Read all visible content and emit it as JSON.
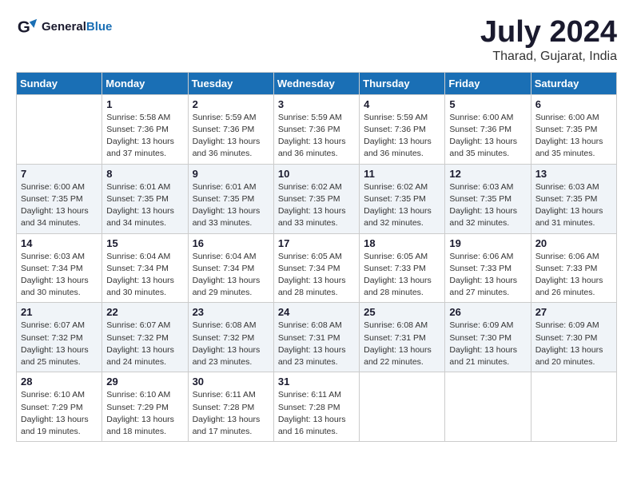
{
  "logo": {
    "text_general": "General",
    "text_blue": "Blue"
  },
  "header": {
    "month": "July 2024",
    "location": "Tharad, Gujarat, India"
  },
  "weekdays": [
    "Sunday",
    "Monday",
    "Tuesday",
    "Wednesday",
    "Thursday",
    "Friday",
    "Saturday"
  ],
  "weeks": [
    [
      {
        "num": "",
        "info": ""
      },
      {
        "num": "1",
        "info": "Sunrise: 5:58 AM\nSunset: 7:36 PM\nDaylight: 13 hours\nand 37 minutes."
      },
      {
        "num": "2",
        "info": "Sunrise: 5:59 AM\nSunset: 7:36 PM\nDaylight: 13 hours\nand 36 minutes."
      },
      {
        "num": "3",
        "info": "Sunrise: 5:59 AM\nSunset: 7:36 PM\nDaylight: 13 hours\nand 36 minutes."
      },
      {
        "num": "4",
        "info": "Sunrise: 5:59 AM\nSunset: 7:36 PM\nDaylight: 13 hours\nand 36 minutes."
      },
      {
        "num": "5",
        "info": "Sunrise: 6:00 AM\nSunset: 7:36 PM\nDaylight: 13 hours\nand 35 minutes."
      },
      {
        "num": "6",
        "info": "Sunrise: 6:00 AM\nSunset: 7:35 PM\nDaylight: 13 hours\nand 35 minutes."
      }
    ],
    [
      {
        "num": "7",
        "info": "Sunrise: 6:00 AM\nSunset: 7:35 PM\nDaylight: 13 hours\nand 34 minutes."
      },
      {
        "num": "8",
        "info": "Sunrise: 6:01 AM\nSunset: 7:35 PM\nDaylight: 13 hours\nand 34 minutes."
      },
      {
        "num": "9",
        "info": "Sunrise: 6:01 AM\nSunset: 7:35 PM\nDaylight: 13 hours\nand 33 minutes."
      },
      {
        "num": "10",
        "info": "Sunrise: 6:02 AM\nSunset: 7:35 PM\nDaylight: 13 hours\nand 33 minutes."
      },
      {
        "num": "11",
        "info": "Sunrise: 6:02 AM\nSunset: 7:35 PM\nDaylight: 13 hours\nand 32 minutes."
      },
      {
        "num": "12",
        "info": "Sunrise: 6:03 AM\nSunset: 7:35 PM\nDaylight: 13 hours\nand 32 minutes."
      },
      {
        "num": "13",
        "info": "Sunrise: 6:03 AM\nSunset: 7:35 PM\nDaylight: 13 hours\nand 31 minutes."
      }
    ],
    [
      {
        "num": "14",
        "info": "Sunrise: 6:03 AM\nSunset: 7:34 PM\nDaylight: 13 hours\nand 30 minutes."
      },
      {
        "num": "15",
        "info": "Sunrise: 6:04 AM\nSunset: 7:34 PM\nDaylight: 13 hours\nand 30 minutes."
      },
      {
        "num": "16",
        "info": "Sunrise: 6:04 AM\nSunset: 7:34 PM\nDaylight: 13 hours\nand 29 minutes."
      },
      {
        "num": "17",
        "info": "Sunrise: 6:05 AM\nSunset: 7:34 PM\nDaylight: 13 hours\nand 28 minutes."
      },
      {
        "num": "18",
        "info": "Sunrise: 6:05 AM\nSunset: 7:33 PM\nDaylight: 13 hours\nand 28 minutes."
      },
      {
        "num": "19",
        "info": "Sunrise: 6:06 AM\nSunset: 7:33 PM\nDaylight: 13 hours\nand 27 minutes."
      },
      {
        "num": "20",
        "info": "Sunrise: 6:06 AM\nSunset: 7:33 PM\nDaylight: 13 hours\nand 26 minutes."
      }
    ],
    [
      {
        "num": "21",
        "info": "Sunrise: 6:07 AM\nSunset: 7:32 PM\nDaylight: 13 hours\nand 25 minutes."
      },
      {
        "num": "22",
        "info": "Sunrise: 6:07 AM\nSunset: 7:32 PM\nDaylight: 13 hours\nand 24 minutes."
      },
      {
        "num": "23",
        "info": "Sunrise: 6:08 AM\nSunset: 7:32 PM\nDaylight: 13 hours\nand 23 minutes."
      },
      {
        "num": "24",
        "info": "Sunrise: 6:08 AM\nSunset: 7:31 PM\nDaylight: 13 hours\nand 23 minutes."
      },
      {
        "num": "25",
        "info": "Sunrise: 6:08 AM\nSunset: 7:31 PM\nDaylight: 13 hours\nand 22 minutes."
      },
      {
        "num": "26",
        "info": "Sunrise: 6:09 AM\nSunset: 7:30 PM\nDaylight: 13 hours\nand 21 minutes."
      },
      {
        "num": "27",
        "info": "Sunrise: 6:09 AM\nSunset: 7:30 PM\nDaylight: 13 hours\nand 20 minutes."
      }
    ],
    [
      {
        "num": "28",
        "info": "Sunrise: 6:10 AM\nSunset: 7:29 PM\nDaylight: 13 hours\nand 19 minutes."
      },
      {
        "num": "29",
        "info": "Sunrise: 6:10 AM\nSunset: 7:29 PM\nDaylight: 13 hours\nand 18 minutes."
      },
      {
        "num": "30",
        "info": "Sunrise: 6:11 AM\nSunset: 7:28 PM\nDaylight: 13 hours\nand 17 minutes."
      },
      {
        "num": "31",
        "info": "Sunrise: 6:11 AM\nSunset: 7:28 PM\nDaylight: 13 hours\nand 16 minutes."
      },
      {
        "num": "",
        "info": ""
      },
      {
        "num": "",
        "info": ""
      },
      {
        "num": "",
        "info": ""
      }
    ]
  ]
}
